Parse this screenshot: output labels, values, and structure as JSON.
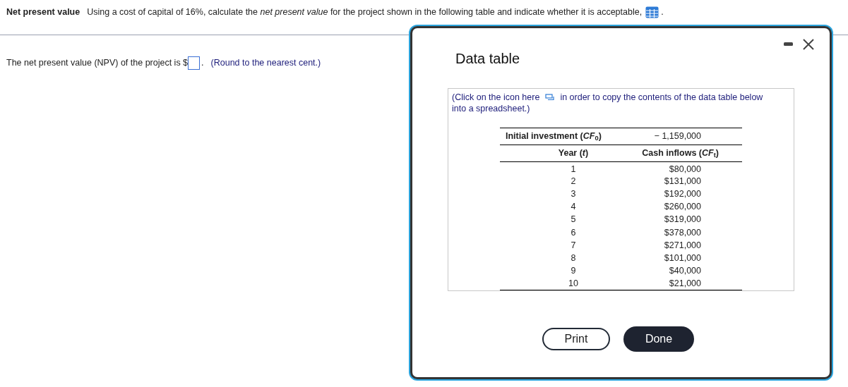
{
  "question": {
    "heading": "Net present value",
    "text": "Using a cost of capital of 16%, calculate the *net present value* for the project shown in the following table and indicate whether it is acceptable,",
    "end": "."
  },
  "answer": {
    "prefix": "The net present value (NPV) of the project is $",
    "suffix": ".",
    "hint": "(Round to the nearest cent.)"
  },
  "dialog": {
    "title": "Data table",
    "note_before": "(Click on the icon here",
    "note_after": "in order to copy the contents of the data table below",
    "note_line2": "into a spreadsheet.)",
    "table": {
      "initial_label": "Initial investment (*CF*$_{0}$)",
      "initial_value": "− 1,159,000",
      "columns": [
        "Year (*t*)",
        "Cash inflows (*CF*$_{t}$)"
      ],
      "rows": [
        [
          "1",
          "$80,000"
        ],
        [
          "2",
          "$131,000"
        ],
        [
          "3",
          "$192,000"
        ],
        [
          "4",
          "$260,000"
        ],
        [
          "5",
          "$319,000"
        ],
        [
          "6",
          "$378,000"
        ],
        [
          "7",
          "$271,000"
        ],
        [
          "8",
          "$101,000"
        ],
        [
          "9",
          "$40,000"
        ],
        [
          "10",
          "$21,000"
        ]
      ]
    },
    "buttons": [
      {
        "label": "Print",
        "kind": "outline"
      },
      {
        "label": "Done",
        "kind": "solid"
      }
    ]
  }
}
